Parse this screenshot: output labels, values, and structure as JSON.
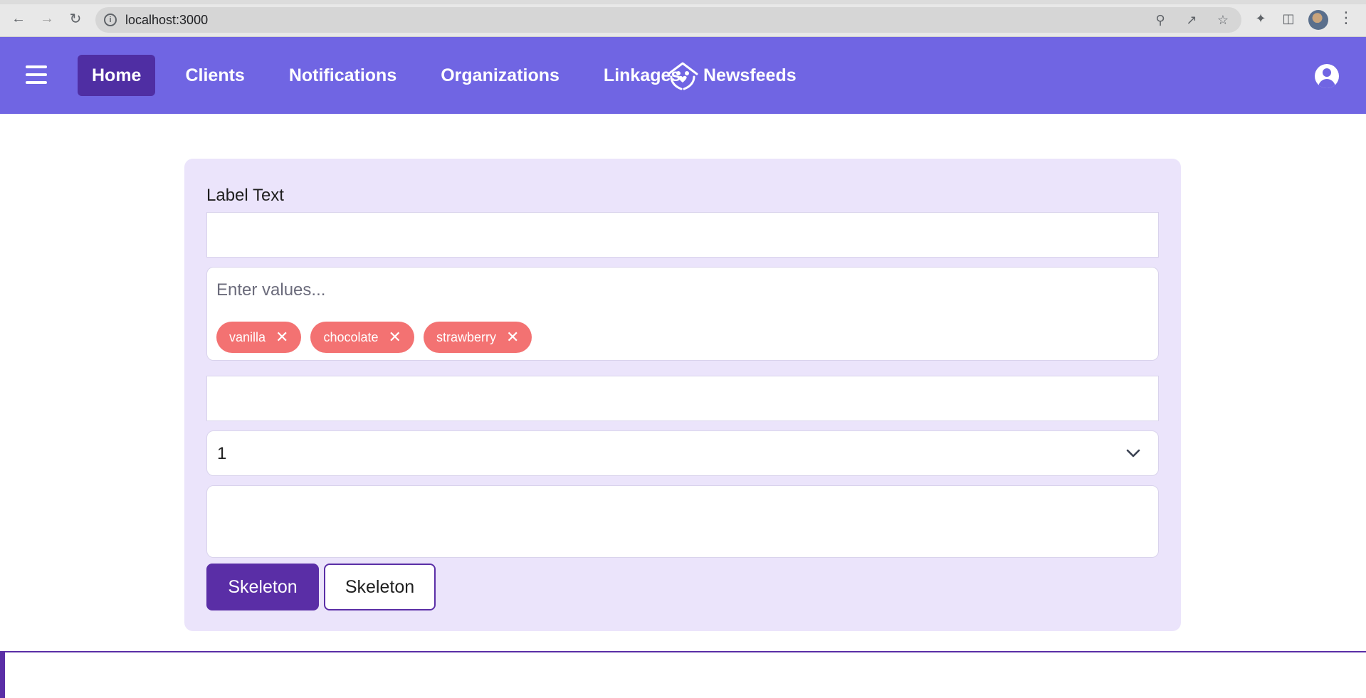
{
  "browser": {
    "url": "localhost:3000"
  },
  "nav": {
    "items": [
      {
        "label": "Home",
        "active": true
      },
      {
        "label": "Clients"
      },
      {
        "label": "Notifications"
      },
      {
        "label": "Organizations"
      },
      {
        "label": "Linkages"
      }
    ],
    "newsfeeds_label": "Newsfeeds",
    "brand_color": "#7065e3",
    "active_color": "#4f2ea3"
  },
  "form": {
    "label": "Label Text",
    "text_input_value": "",
    "tags_placeholder": "Enter values...",
    "tags": [
      "vanilla",
      "chocolate",
      "strawberry"
    ],
    "tag_color": "#f37272",
    "second_input_value": "",
    "select_value": "1",
    "textarea_value": "",
    "primary_button": "Skeleton",
    "secondary_button": "Skeleton",
    "card_color": "#ebe4fb",
    "button_color": "#5a2ea6"
  }
}
